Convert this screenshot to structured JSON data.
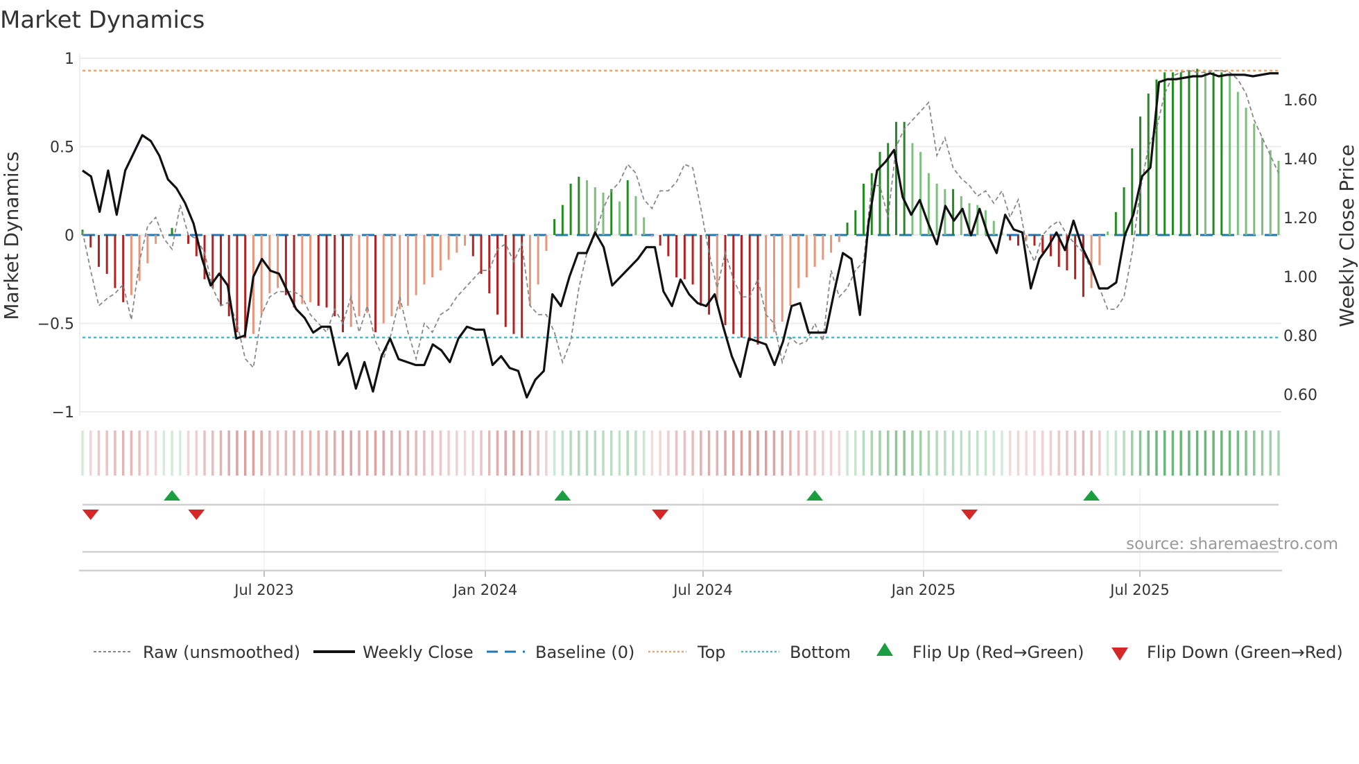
{
  "chart_data": {
    "type": "bar",
    "title": "Market Dynamics",
    "ylabel": "Market Dynamics",
    "y2label": "Weekly Close Price",
    "ylim": [
      -1,
      1
    ],
    "y2lim": [
      0.5,
      1.7
    ],
    "yticks": [
      "1",
      "0.5",
      "0",
      "−0.5",
      "−1"
    ],
    "ytick_values": [
      1,
      0.5,
      0,
      -0.5,
      -1
    ],
    "y2ticks": [
      "1.60",
      "1.40",
      "1.20",
      "1.00",
      "0.80",
      "0.60"
    ],
    "y2tick_values": [
      1.6,
      1.4,
      1.2,
      1.0,
      0.8,
      0.6
    ],
    "xticks": [
      "Jul 2023",
      "Jan 2024",
      "Jul 2024",
      "Jan 2025",
      "Jul 2025"
    ],
    "x_frequency": "weekly",
    "x_range": [
      "Feb 2023",
      "Oct 2025"
    ],
    "top_level": 0.93,
    "bottom_level": -0.58,
    "baseline": 0,
    "grid": true,
    "legend_placement": "bottom",
    "source": "source: sharemaestro.com",
    "colors": {
      "up_strong": "#228b22",
      "up_weak": "#7dbf7d",
      "down_strong": "#b22222",
      "down_weak": "#e8967a",
      "close": "#111111",
      "raw": "#888888",
      "baseline": "#1f77b4",
      "top": "#f4a460",
      "bottom": "#2ec4d6",
      "flip_up": "#1a9e3f",
      "flip_down": "#d62728"
    },
    "series": [
      {
        "name": "Market Dynamics",
        "values": [
          0.03,
          -0.07,
          -0.18,
          -0.22,
          -0.3,
          -0.38,
          -0.34,
          -0.26,
          -0.16,
          -0.05,
          0.0,
          0.04,
          0.0,
          -0.05,
          -0.12,
          -0.25,
          -0.3,
          -0.4,
          -0.46,
          -0.55,
          -0.58,
          -0.56,
          -0.45,
          -0.33,
          -0.3,
          -0.34,
          -0.41,
          -0.39,
          -0.38,
          -0.4,
          -0.41,
          -0.46,
          -0.55,
          -0.52,
          -0.46,
          -0.44,
          -0.55,
          -0.5,
          -0.46,
          -0.42,
          -0.4,
          -0.34,
          -0.28,
          -0.24,
          -0.2,
          -0.14,
          -0.1,
          -0.06,
          -0.12,
          -0.22,
          -0.33,
          -0.45,
          -0.52,
          -0.56,
          -0.58,
          -0.4,
          -0.28,
          -0.09,
          0.09,
          0.17,
          0.29,
          0.33,
          0.31,
          0.27,
          0.24,
          0.26,
          0.19,
          0.31,
          0.22,
          0.1,
          -0.01,
          -0.06,
          -0.12,
          -0.24,
          -0.25,
          -0.28,
          -0.4,
          -0.45,
          -0.4,
          -0.51,
          -0.56,
          -0.58,
          -0.6,
          -0.62,
          -0.58,
          -0.55,
          -0.49,
          -0.4,
          -0.3,
          -0.24,
          -0.18,
          -0.14,
          -0.1,
          -0.04,
          0.07,
          0.14,
          0.29,
          0.35,
          0.47,
          0.52,
          0.64,
          0.64,
          0.52,
          0.47,
          0.35,
          0.29,
          0.26,
          0.26,
          0.22,
          0.18,
          0.17,
          0.14,
          0.08,
          0.02,
          -0.03,
          -0.06,
          -0.03,
          -0.06,
          -0.1,
          -0.12,
          -0.18,
          -0.2,
          -0.25,
          -0.35,
          -0.3,
          -0.17,
          0.02,
          0.13,
          0.27,
          0.49,
          0.67,
          0.8,
          0.88,
          0.92,
          0.92,
          0.92,
          0.93,
          0.94,
          0.92,
          0.92,
          0.92,
          0.9,
          0.81,
          0.72,
          0.63,
          0.55,
          0.48,
          0.42
        ]
      },
      {
        "name": "Raw (unsmoothed)",
        "values": [
          0.02,
          -0.2,
          -0.4,
          -0.36,
          -0.33,
          -0.28,
          -0.48,
          -0.15,
          0.05,
          0.1,
          -0.02,
          -0.08,
          0.17,
          0.0,
          -0.02,
          -0.1,
          -0.3,
          -0.4,
          -0.38,
          -0.5,
          -0.7,
          -0.75,
          -0.45,
          -0.35,
          -0.32,
          -0.32,
          -0.32,
          -0.35,
          -0.45,
          -0.5,
          -0.55,
          -0.42,
          -0.5,
          -0.35,
          -0.55,
          -0.4,
          -0.6,
          -0.7,
          -0.55,
          -0.35,
          -0.55,
          -0.7,
          -0.5,
          -0.55,
          -0.45,
          -0.42,
          -0.35,
          -0.3,
          -0.25,
          -0.2,
          -0.2,
          -0.08,
          -0.05,
          -0.15,
          -0.05,
          -0.4,
          -0.45,
          -0.45,
          -0.55,
          -0.72,
          -0.6,
          -0.3,
          -0.1,
          0.0,
          0.15,
          0.25,
          0.3,
          0.4,
          0.35,
          0.2,
          0.15,
          0.25,
          0.25,
          0.3,
          0.4,
          0.38,
          0.15,
          -0.1,
          -0.3,
          -0.1,
          -0.25,
          -0.35,
          -0.35,
          -0.25,
          -0.45,
          -0.5,
          -0.72,
          -0.58,
          -0.62,
          -0.6,
          -0.5,
          -0.6,
          -0.2,
          -0.35,
          -0.3,
          -0.2,
          -0.15,
          0.28,
          0.28,
          0.1,
          0.5,
          0.6,
          0.65,
          0.7,
          0.75,
          0.45,
          0.55,
          0.38,
          0.32,
          0.28,
          0.22,
          0.25,
          0.18,
          0.25,
          0.1,
          0.2,
          -0.05,
          -0.15,
          0.0,
          0.05,
          0.08,
          0.0,
          -0.05,
          -0.1,
          -0.2,
          -0.3,
          -0.42,
          -0.42,
          -0.35,
          -0.1,
          0.25,
          0.5,
          0.6,
          0.8,
          0.9,
          0.92,
          0.93,
          0.92,
          0.92,
          0.93,
          0.93,
          0.92,
          0.88,
          0.8,
          0.65,
          0.55,
          0.45,
          0.35
        ]
      },
      {
        "name": "Weekly Close",
        "axis": "right",
        "values": [
          1.36,
          1.34,
          1.22,
          1.36,
          1.21,
          1.36,
          1.42,
          1.48,
          1.46,
          1.41,
          1.33,
          1.3,
          1.25,
          1.18,
          1.06,
          0.97,
          1.01,
          0.97,
          0.79,
          0.8,
          1.0,
          1.06,
          1.02,
          1.01,
          0.95,
          0.89,
          0.86,
          0.81,
          0.83,
          0.83,
          0.7,
          0.74,
          0.62,
          0.71,
          0.61,
          0.73,
          0.79,
          0.72,
          0.71,
          0.7,
          0.7,
          0.77,
          0.75,
          0.71,
          0.79,
          0.83,
          0.82,
          0.82,
          0.7,
          0.73,
          0.69,
          0.68,
          0.59,
          0.65,
          0.68,
          0.94,
          0.9,
          1.0,
          1.08,
          1.08,
          1.15,
          1.1,
          0.97,
          1.0,
          1.03,
          1.06,
          1.1,
          1.1,
          0.95,
          0.9,
          0.99,
          0.94,
          0.91,
          0.9,
          0.94,
          0.83,
          0.73,
          0.66,
          0.79,
          0.78,
          0.77,
          0.7,
          0.78,
          0.9,
          0.91,
          0.81,
          0.81,
          0.81,
          0.95,
          1.08,
          1.06,
          0.87,
          1.18,
          1.36,
          1.39,
          1.43,
          1.27,
          1.21,
          1.26,
          1.18,
          1.11,
          1.24,
          1.19,
          1.23,
          1.14,
          1.23,
          1.14,
          1.08,
          1.21,
          1.16,
          1.15,
          0.96,
          1.06,
          1.1,
          1.15,
          1.09,
          1.19,
          1.1,
          1.04,
          0.96,
          0.96,
          0.98,
          1.14,
          1.21,
          1.34,
          1.37,
          1.66,
          1.67,
          1.67,
          1.675,
          1.68,
          1.68,
          1.69,
          1.68,
          1.685,
          1.685,
          1.685,
          1.68,
          1.685,
          1.69,
          1.69
        ]
      }
    ],
    "flip_up_week_index": [
      11,
      59,
      90,
      124
    ],
    "flip_down_week_index": [
      1,
      14,
      71,
      109
    ],
    "legend": [
      "Raw (unsmoothed)",
      "Weekly Close",
      "Baseline (0)",
      "Top",
      "Bottom",
      "Flip Up (Red→Green)",
      "Flip Down (Green→Red)"
    ]
  }
}
